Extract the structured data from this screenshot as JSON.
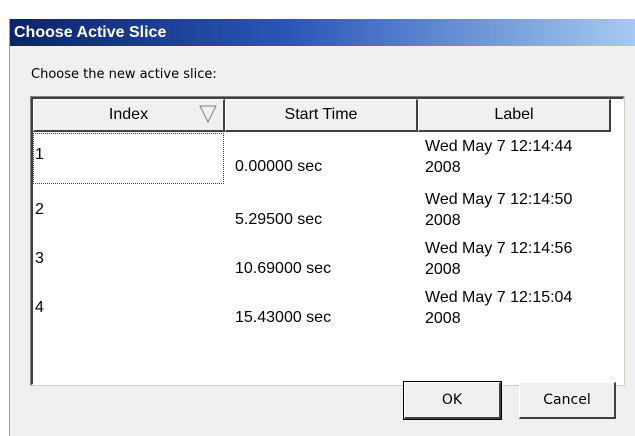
{
  "dialog": {
    "title": "Choose Active Slice",
    "prompt": "Choose the new active slice:"
  },
  "table": {
    "columns": [
      "Index",
      "Start Time",
      "Label"
    ],
    "sorted_column": "Index",
    "rows": [
      {
        "index": "1",
        "start": "0.00000 sec",
        "label_line1": "Wed May 7 12:14:44",
        "label_line2": "2008"
      },
      {
        "index": "2",
        "start": "5.29500 sec",
        "label_line1": "Wed May 7 12:14:50",
        "label_line2": "2008"
      },
      {
        "index": "3",
        "start": "10.69000 sec",
        "label_line1": "Wed May 7 12:14:56",
        "label_line2": "2008"
      },
      {
        "index": "4",
        "start": "15.43000 sec",
        "label_line1": "Wed May 7 12:15:04",
        "label_line2": "2008"
      }
    ]
  },
  "buttons": {
    "ok": "OK",
    "cancel": "Cancel"
  },
  "colors": {
    "title_gradient_start": "#0a246a",
    "title_gradient_end": "#a6caf0",
    "dialog_bg": "#f0f0f0"
  }
}
